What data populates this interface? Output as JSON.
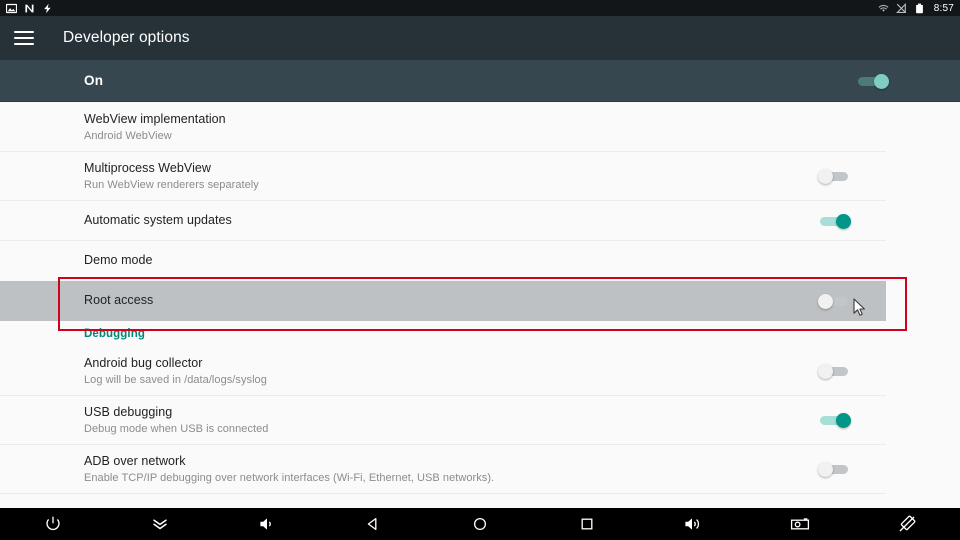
{
  "statusbar": {
    "icons_left": [
      "image-icon",
      "nfc-icon",
      "usb-charging-icon"
    ],
    "icons_right": [
      "cast-icon",
      "no-signal-icon",
      "battery-icon"
    ],
    "clock": "8:57"
  },
  "appbar": {
    "menu_icon": "hamburger-menu-icon",
    "title": "Developer options"
  },
  "master_switch": {
    "label": "On",
    "state": "on"
  },
  "settings": [
    {
      "name": "webview-implementation",
      "title": "WebView implementation",
      "subtitle": "Android WebView",
      "control": "none"
    },
    {
      "name": "multiprocess-webview",
      "title": "Multiprocess WebView",
      "subtitle": "Run WebView renderers separately",
      "control": "switch",
      "state": "off"
    },
    {
      "name": "automatic-system-updates",
      "title": "Automatic system updates",
      "subtitle": "",
      "control": "switch",
      "state": "on"
    },
    {
      "name": "demo-mode",
      "title": "Demo mode",
      "subtitle": "",
      "control": "none"
    },
    {
      "name": "root-access",
      "title": "Root access",
      "subtitle": "",
      "control": "switch",
      "state": "off",
      "highlighted": true,
      "pressed": true
    }
  ],
  "debugging_section": {
    "header": "Debugging",
    "items": [
      {
        "name": "android-bug-collector",
        "title": "Android bug collector",
        "subtitle": "Log will be saved in /data/logs/syslog",
        "control": "switch",
        "state": "off"
      },
      {
        "name": "usb-debugging",
        "title": "USB debugging",
        "subtitle": "Debug mode when USB is connected",
        "control": "switch",
        "state": "on"
      },
      {
        "name": "adb-over-network",
        "title": "ADB over network",
        "subtitle": "Enable TCP/IP debugging over network interfaces (Wi-Fi, Ethernet, USB networks).",
        "control": "switch",
        "state": "off"
      }
    ]
  },
  "navbar": {
    "buttons": [
      {
        "name": "power-button",
        "icon": "power-icon"
      },
      {
        "name": "collapse-button",
        "icon": "double-chevron-down-icon"
      },
      {
        "name": "volume-down-button",
        "icon": "volume-down-icon"
      },
      {
        "name": "back-button",
        "icon": "back-triangle-icon"
      },
      {
        "name": "home-button",
        "icon": "home-circle-icon"
      },
      {
        "name": "recents-button",
        "icon": "recents-square-icon"
      },
      {
        "name": "volume-up-button",
        "icon": "volume-up-icon"
      },
      {
        "name": "screenshot-button",
        "icon": "camera-icon"
      },
      {
        "name": "rotate-button",
        "icon": "screen-rotate-icon"
      }
    ]
  },
  "annotation": {
    "color": "#d0021b",
    "target": "root-access"
  },
  "colors": {
    "statusbar_bg": "#121619",
    "appbar_bg": "#273238",
    "masterbar_bg": "#37474f",
    "content_bg": "#fafafa",
    "accent": "#009688",
    "section_header": "#00897b",
    "annotation": "#d0021b",
    "pressed_row": "#bdc1c4"
  }
}
